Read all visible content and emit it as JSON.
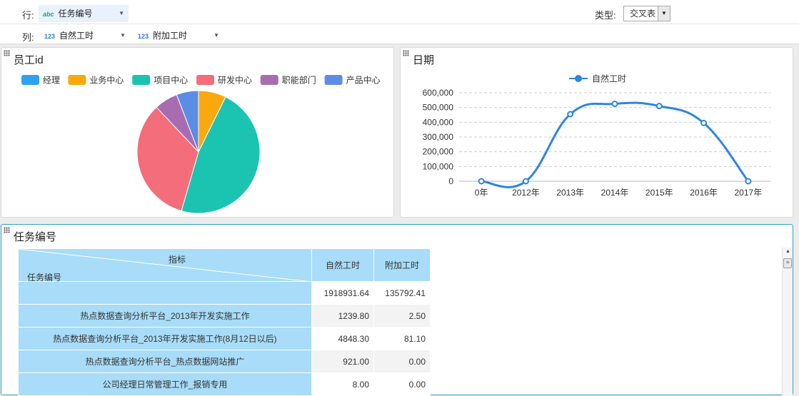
{
  "toolbar": {
    "row_label": "行:",
    "col_label": "列:",
    "row_fields": [
      {
        "type": "abc",
        "label": "任务编号"
      }
    ],
    "col_fields": [
      {
        "type": "123",
        "label": "自然工时"
      },
      {
        "type": "123",
        "label": "附加工时"
      }
    ],
    "type_label": "类型:",
    "type_value": "交叉表"
  },
  "pie_panel": {
    "title": "员工id",
    "legend": [
      "经理",
      "业务中心",
      "项目中心",
      "研发中心",
      "职能部门",
      "产品中心"
    ],
    "colors": {
      "经理": "#2ea2f0",
      "业务中心": "#f9a90e",
      "项目中心": "#1bc4b0",
      "研发中心": "#f46d7a",
      "职能部门": "#a86db1",
      "产品中心": "#5b8de5"
    }
  },
  "line_panel": {
    "title": "日期",
    "color": "#2e86e0"
  },
  "chart_data": [
    {
      "type": "pie",
      "title": "员工id",
      "categories": [
        "经理",
        "业务中心",
        "项目中心",
        "研发中心",
        "职能部门",
        "产品中心"
      ],
      "values": [
        0.0,
        7.3,
        47.2,
        33.5,
        6.2,
        5.8
      ]
    },
    {
      "type": "line",
      "title": "日期",
      "categories": [
        "0年",
        "2012年",
        "2013年",
        "2014年",
        "2015年",
        "2016年",
        "2017年"
      ],
      "series": [
        {
          "name": "自然工时",
          "values": [
            0,
            0,
            455000,
            525000,
            510000,
            395000,
            0
          ]
        }
      ],
      "ylim": [
        0,
        600000
      ],
      "yticks": [
        "0",
        "100,000",
        "200,000",
        "300,000",
        "400,000",
        "500,000",
        "600,000"
      ],
      "grid": true,
      "legend": "top-center"
    }
  ],
  "table_panel": {
    "title": "任务编号",
    "corner_top": "指标",
    "corner_bottom": "任务编号",
    "columns": [
      "自然工时",
      "附加工时"
    ],
    "rows": [
      {
        "label": "",
        "v1": "1918931.64",
        "v2": "135792.41"
      },
      {
        "label": "热点数据查询分析平台_2013年开发实施工作",
        "v1": "1239.80",
        "v2": "2.50"
      },
      {
        "label": "热点数据查询分析平台_2013年开发实施工作(8月12日以后)",
        "v1": "4848.30",
        "v2": "81.10"
      },
      {
        "label": "热点数据查询分析平台_热点数据网站推广",
        "v1": "921.00",
        "v2": "0.00"
      },
      {
        "label": "公司经理日常管理工作_报销专用",
        "v1": "8.00",
        "v2": "0.00"
      }
    ]
  }
}
